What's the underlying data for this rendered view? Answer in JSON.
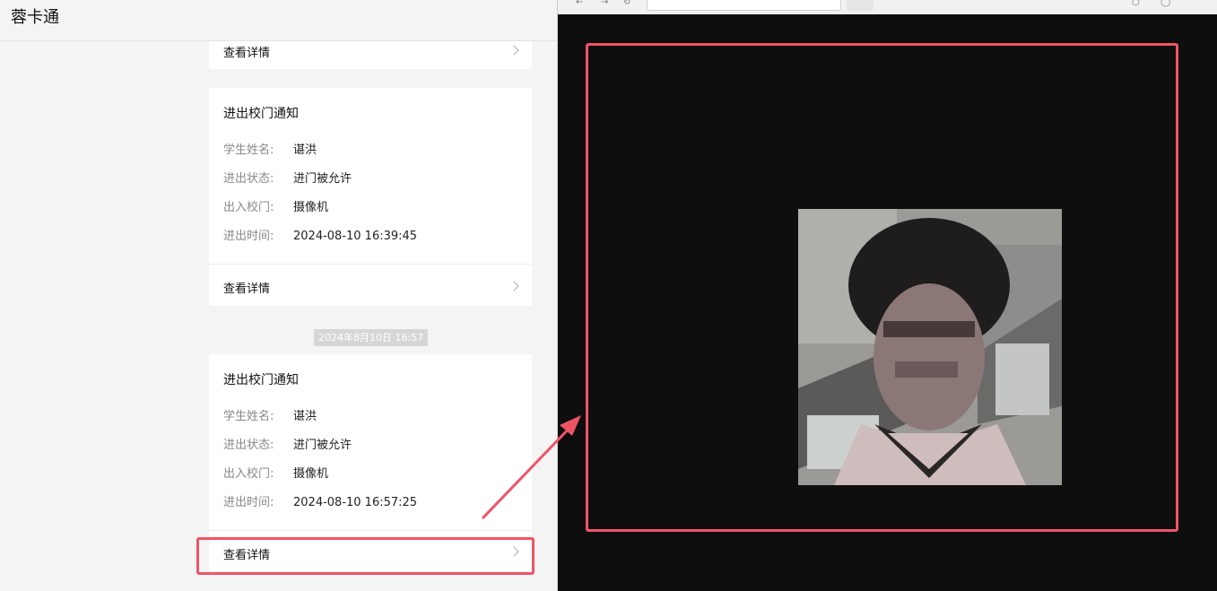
{
  "app": {
    "title": "蓉卡通"
  },
  "cards": [
    {
      "detail_label": "查看详情"
    },
    {
      "title": "进出校门通知",
      "fields": [
        {
          "label": "学生姓名:",
          "value": "谌洪"
        },
        {
          "label": "进出状态:",
          "value": "进门被允许"
        },
        {
          "label": "出入校门:",
          "value": "摄像机"
        },
        {
          "label": "进出时间:",
          "value": "2024-08-10 16:39:45"
        }
      ],
      "detail_label": "查看详情"
    },
    {
      "title": "进出校门通知",
      "fields": [
        {
          "label": "学生姓名:",
          "value": "谌洪"
        },
        {
          "label": "进出状态:",
          "value": "进门被允许"
        },
        {
          "label": "出入校门:",
          "value": "摄像机"
        },
        {
          "label": "进出时间:",
          "value": "2024-08-10 16:57:25"
        }
      ],
      "detail_label": "查看详情"
    }
  ],
  "timestamp": "2024年8月10日 16:57",
  "browser": {
    "url": ""
  },
  "colors": {
    "highlight": "#ef5466",
    "viewer_bg": "#0e0e0e"
  },
  "icons": [
    "chevron-right-icon",
    "back-icon",
    "forward-icon",
    "reload-icon",
    "globe-icon"
  ]
}
